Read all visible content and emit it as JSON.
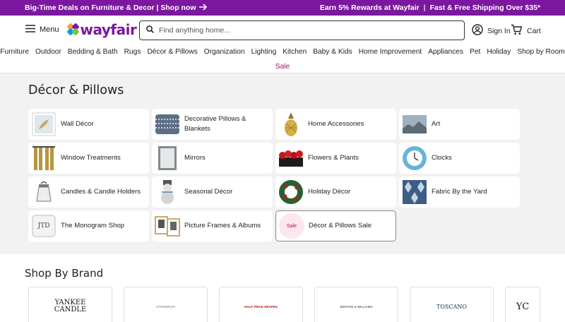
{
  "promo": {
    "left": "Big-Time Deals on Furniture & Decor | Shop now",
    "rewards": "Earn 5% Rewards at Wayfair",
    "shipping": "Fast & Free Shipping Over $35*"
  },
  "header": {
    "menu_label": "Menu",
    "logo_text": "wayfair",
    "search_placeholder": "Find anything home...",
    "signin_label": "Sign In",
    "cart_label": "Cart"
  },
  "nav": {
    "items": [
      "Furniture",
      "Outdoor",
      "Bedding & Bath",
      "Rugs",
      "Décor & Pillows",
      "Organization",
      "Lighting",
      "Kitchen",
      "Baby & Kids",
      "Home Improvement",
      "Appliances",
      "Pet",
      "Holiday",
      "Shop by Room"
    ],
    "sale": "Sale"
  },
  "page": {
    "title": "Décor & Pillows",
    "categories": [
      {
        "label": "Wall Décor",
        "icon": "wall-decor-thumb"
      },
      {
        "label": "Decorative Pillows & Blankets",
        "icon": "pillow-thumb"
      },
      {
        "label": "Home Accessories",
        "icon": "pineapple-thumb"
      },
      {
        "label": "Art",
        "icon": "art-thumb"
      },
      {
        "label": "Window Treatments",
        "icon": "curtain-thumb"
      },
      {
        "label": "Mirrors",
        "icon": "mirror-thumb"
      },
      {
        "label": "Flowers & Plants",
        "icon": "flowers-thumb"
      },
      {
        "label": "Clocks",
        "icon": "clock-thumb"
      },
      {
        "label": "Candles & Candle Holders",
        "icon": "lantern-thumb"
      },
      {
        "label": "Seasonal Décor",
        "icon": "snowman-thumb"
      },
      {
        "label": "Holiday Décor",
        "icon": "wreath-thumb"
      },
      {
        "label": "Fabric By the Yard",
        "icon": "fabric-thumb"
      },
      {
        "label": "The Monogram Shop",
        "icon": "monogram-pillow-thumb",
        "monogram": "JTD"
      },
      {
        "label": "Picture Frames & Albums",
        "icon": "frames-thumb"
      },
      {
        "label": "Décor & Pillows Sale",
        "icon": "sale-badge",
        "badge": "Sale"
      }
    ]
  },
  "brands": {
    "title": "Shop By Brand",
    "items": [
      {
        "logo": "YANKEE CANDLE",
        "name": "yankee-candle"
      },
      {
        "logo": "UTTERMOST",
        "name": "uttermost"
      },
      {
        "logo": "HALF PRICE DRAPES",
        "name": "half-price-drapes"
      },
      {
        "logo": "BENTON & WILLIAMS",
        "name": "benton-williams"
      },
      {
        "logo": "TOSCANO",
        "name": "toscano"
      },
      {
        "logo": "YC",
        "name": "partial-brand"
      }
    ]
  },
  "colors": {
    "brand_purple": "#7b189f",
    "sale_red": "#a1125c",
    "section_bg": "#f2f2f2"
  }
}
